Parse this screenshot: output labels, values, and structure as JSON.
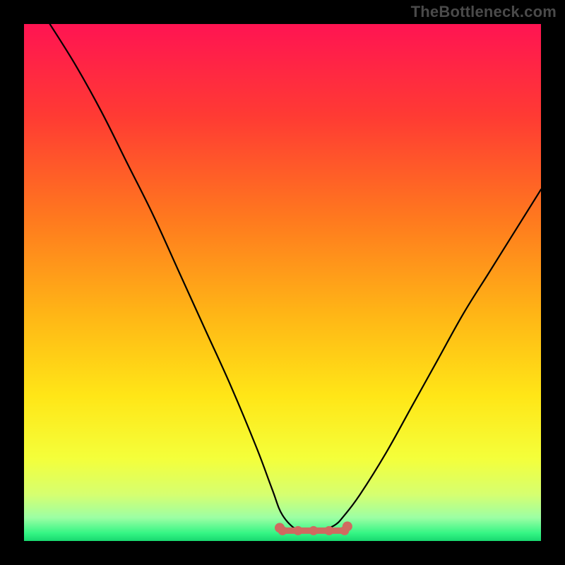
{
  "watermark": "TheBottleneck.com",
  "colors": {
    "frame": "#000000",
    "gradient_stops": [
      {
        "offset": 0.0,
        "color": "#ff1452"
      },
      {
        "offset": 0.18,
        "color": "#ff3b33"
      },
      {
        "offset": 0.38,
        "color": "#ff7a1e"
      },
      {
        "offset": 0.56,
        "color": "#ffb516"
      },
      {
        "offset": 0.72,
        "color": "#ffe617"
      },
      {
        "offset": 0.84,
        "color": "#f4ff3a"
      },
      {
        "offset": 0.91,
        "color": "#d6ff70"
      },
      {
        "offset": 0.955,
        "color": "#9cffa4"
      },
      {
        "offset": 0.985,
        "color": "#34f584"
      },
      {
        "offset": 1.0,
        "color": "#18d86f"
      }
    ],
    "curve_stroke": "#000000",
    "pill_fill": "#cf6a60",
    "pill_stroke": "#cf6a60"
  },
  "chart_data": {
    "type": "line",
    "title": "",
    "xlabel": "",
    "ylabel": "",
    "xlim": [
      0,
      100
    ],
    "ylim": [
      0,
      100
    ],
    "grid": false,
    "legend": false,
    "series": [
      {
        "name": "bottleneck-curve",
        "x": [
          5,
          10,
          15,
          20,
          25,
          30,
          35,
          40,
          45,
          48,
          50,
          53,
          55,
          57,
          60,
          62,
          65,
          70,
          75,
          80,
          85,
          90,
          95,
          100
        ],
        "y": [
          100,
          92,
          83,
          73,
          63,
          52,
          41,
          30,
          18,
          10,
          5,
          2,
          2,
          2,
          3,
          5,
          9,
          17,
          26,
          35,
          44,
          52,
          60,
          68
        ]
      }
    ],
    "annotations": [
      {
        "name": "flat-bottom-pill",
        "x_start": 50,
        "x_end": 62,
        "y": 2
      }
    ]
  }
}
